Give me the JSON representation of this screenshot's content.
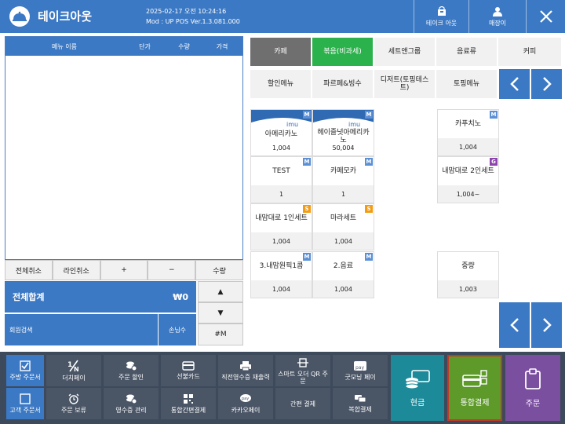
{
  "header": {
    "title": "테이크아웃",
    "datetime": "2025-02-17 오전 10:24:16",
    "mod": "Mod : UP POS Ver.1.3.081.000",
    "takeout_label": "테이크 아웃",
    "staff_label": "매장이"
  },
  "order": {
    "columns": [
      "메뉴 이름",
      "단가",
      "수량",
      "가격"
    ],
    "buttons": [
      "전체취소",
      "라인취소",
      "+",
      "−",
      "수량"
    ],
    "total_label": "전체합계",
    "total_value": "₩0",
    "member_label": "회원검색",
    "guests_label": "손님수",
    "qty_up": "▲",
    "qty_down": "▼",
    "table_label": "#M"
  },
  "categories": {
    "row1": [
      "카페",
      "볶음(비과세)",
      "세트앤그룹",
      "음료류",
      "커피"
    ],
    "row2": [
      "할인메뉴",
      "파르페&빙수",
      "디저트(토핑테스트)",
      "토핑메뉴"
    ]
  },
  "items": [
    {
      "name": "아메리카노",
      "price": "1,004",
      "badge": "M",
      "img": true,
      "img_text": "imu"
    },
    {
      "name": "헤이즐넛아메리카노",
      "price": "50,004",
      "badge": "M",
      "img": true,
      "img_text": "imu"
    },
    {
      "name": "카푸치노",
      "price": "1,004",
      "badge": "M",
      "img": false
    },
    {
      "name": "TEST",
      "price": "1",
      "badge": "M",
      "img": false
    },
    {
      "name": "카페모카",
      "price": "1",
      "badge": "M",
      "img": false
    },
    {
      "name": "내맘대로 2인세트",
      "price": "1,004~",
      "badge": "G",
      "img": false
    },
    {
      "name": "내맘대로 1인세트",
      "price": "1,004",
      "badge": "S",
      "img": false
    },
    {
      "name": "마라세트",
      "price": "1,004",
      "badge": "S",
      "img": false
    },
    {
      "name": "3.내맘원픽1콤",
      "price": "1,004",
      "badge": "M",
      "img": false
    },
    {
      "name": "2.음료",
      "price": "1,004",
      "badge": "M",
      "img": false
    },
    {
      "name": "중량",
      "price": "1,003",
      "badge": "",
      "img": false
    }
  ],
  "footer": {
    "row1": [
      "주방 주문서",
      "더치페이",
      "주문 할인",
      "선불카드",
      "직전영수증 재출력",
      "스마트 오더 QR 주문",
      "굿모닝 페이"
    ],
    "row2": [
      "고객 주문서",
      "주문 보류",
      "영수증 관리",
      "통합간편결제",
      "카카오페이",
      "간편 결제",
      "복합결제"
    ],
    "cash": "현금",
    "integrated": "통합결제",
    "order": "주문",
    "pay_icon_text": "pay"
  },
  "colors": {
    "primary": "#3c79c4",
    "green": "#2bb24c",
    "integrated_bg": "#5d9a2a",
    "integrated_border": "#c0392b",
    "cash_bg": "#1c8a99",
    "order_bg": "#7b4fa0",
    "badge_m": "#5b8fd6",
    "badge_s": "#f39c12",
    "badge_g": "#8e44ad"
  }
}
